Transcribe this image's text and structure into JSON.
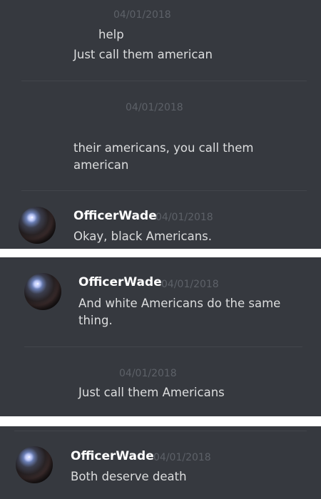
{
  "panel1": {
    "ts_top": "04/01/2018",
    "msg_help": "help",
    "msg_just_call": "Just call them american",
    "ts_mid": "04/01/2018",
    "msg_their_line1": "their americans, you call them",
    "msg_their_line2": "american",
    "author": "OfficerWade",
    "author_ts": "04/01/2018",
    "msg_okay": "Okay, black Americans."
  },
  "panel2": {
    "author": "OfficerWade",
    "author_ts": "04/01/2018",
    "msg_white_line1": "And white Americans do the same",
    "msg_white_line2": "thing.",
    "ts_mid": "04/01/2018",
    "msg_just_call": "Just call them Americans"
  },
  "panel3": {
    "author": "OfficerWade",
    "author_ts": "04/01/2018",
    "msg_both": "Both deserve death"
  }
}
